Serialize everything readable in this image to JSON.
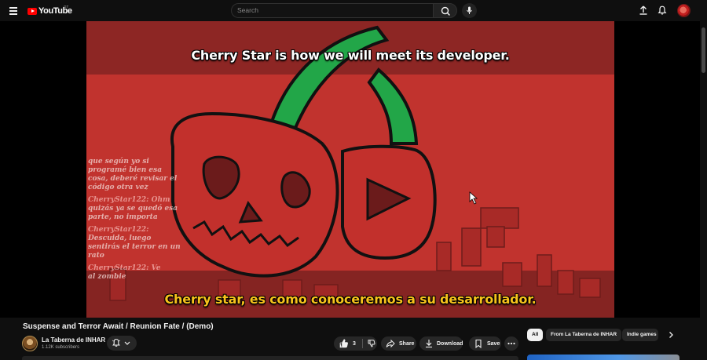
{
  "header": {
    "logo_text": "YouTube",
    "logo_country": "GT",
    "search_placeholder": "Search"
  },
  "video": {
    "caption_top": "Cherry Star is how we will meet its developer.",
    "caption_bottom": "Cherry star, es como conoceremos a su desarrollador.",
    "chat_lines": [
      "que según yo si",
      "programé bien esa",
      "cosa, deberé revisar el",
      "código otra vez",
      "CherryStar122: Ohm",
      "quizás ya se quedó esa",
      "parte, no importa",
      "CherryStar122:",
      "Descuida, luego",
      "sentirás el terror en un",
      "rato",
      "CherryStar122: Ve",
      "al zombie"
    ],
    "colors": {
      "background": "#c1332e",
      "stem": "#1fa84a",
      "caption_bottom": "#f7c21c"
    }
  },
  "meta": {
    "title": "Suspense and Terror Await / Reunion Fate / (Demo)",
    "channel_name": "La Taberna de INHAR",
    "subscribers": "1.12K subscribers"
  },
  "actions": {
    "like_count": "3",
    "share_label": "Share",
    "download_label": "Download",
    "save_label": "Save"
  },
  "chips": {
    "all": "All",
    "from_channel": "From La Taberna de INHAR",
    "indie_games": "Indie games"
  }
}
